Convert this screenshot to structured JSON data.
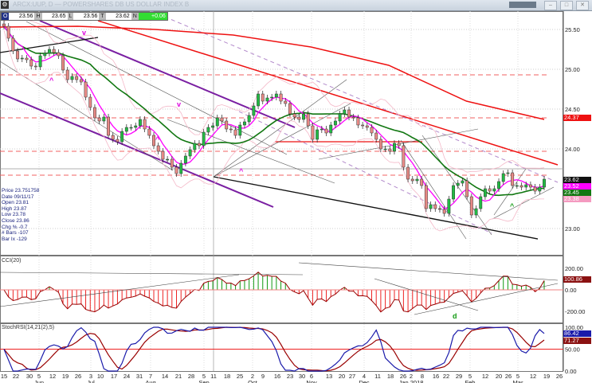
{
  "window": {
    "title": "ARCX:UUP, D — POWERSHARES DB US DOLLAR INDEX B",
    "buttons": [
      "minimize",
      "restore",
      "close"
    ]
  },
  "ohlc_bar": {
    "o_label": "O",
    "o": "23.56",
    "h_label": "H",
    "h": "23.65",
    "l_label": "L",
    "l": "23.56",
    "t_label": "T",
    "t": "23.62",
    "n_label": "N",
    "n": "+0.06"
  },
  "info_panel": {
    "price": "Price  23.751758",
    "date": "Date  09/11/17",
    "open": "Open  23.81",
    "high": "High  23.87",
    "low": "Low  23.78",
    "close": "Close  23.86",
    "chg": "Chg %  -0.7",
    "bars": "# Bars -107",
    "barix": "Bar Ix  -129"
  },
  "colors": {
    "up": "#22bb44",
    "down": "#e88a86",
    "ma_short": "#ff00ff",
    "ma_mid": "#117711",
    "ma_long": "#ee1111",
    "band": "#f4b8c8",
    "cci_pos": "#119911",
    "cci_neg": "#ee2222",
    "stoch_k": "#1a1aaa",
    "stoch_d": "#990000"
  },
  "chart_data": [
    {
      "type": "candlestick",
      "panel": "price",
      "y_ticks": [
        "25.50",
        "25.00",
        "24.50",
        "24.00",
        "23.00"
      ],
      "ylim": [
        22.67,
        25.73
      ],
      "grid": true,
      "closes": [
        25.54,
        25.39,
        25.23,
        25.13,
        25.14,
        25.12,
        25.04,
        25.03,
        25.17,
        25.2,
        25.25,
        25.21,
        25.17,
        24.99,
        24.87,
        24.91,
        24.87,
        24.84,
        24.65,
        24.52,
        24.39,
        24.35,
        24.4,
        24.17,
        24.12,
        24.09,
        24.22,
        24.27,
        24.27,
        24.29,
        24.37,
        24.25,
        24.17,
        24.04,
        23.97,
        23.87,
        23.87,
        23.77,
        23.69,
        23.82,
        23.91,
        23.99,
        24.07,
        24.04,
        24.21,
        24.27,
        24.29,
        24.39,
        24.35,
        24.25,
        24.24,
        24.17,
        24.3,
        24.34,
        24.42,
        24.54,
        24.69,
        24.6,
        24.64,
        24.65,
        24.69,
        24.6,
        24.57,
        24.44,
        24.4,
        24.37,
        24.44,
        24.29,
        24.12,
        24.24,
        24.25,
        24.2,
        24.3,
        24.35,
        24.44,
        24.49,
        24.4,
        24.39,
        24.3,
        24.29,
        24.27,
        24.2,
        24.12,
        24.0,
        24.0,
        23.97,
        24.07,
        24.04,
        23.77,
        23.62,
        23.6,
        23.62,
        23.54,
        23.25,
        23.3,
        23.25,
        23.24,
        23.19,
        23.37,
        23.54,
        23.57,
        23.6,
        23.4,
        23.17,
        23.25,
        23.4,
        23.5,
        23.47,
        23.5,
        23.59,
        23.69,
        23.7,
        23.54,
        23.54,
        23.52,
        23.55,
        23.52,
        23.47,
        23.52,
        23.62
      ],
      "ma_long_values": [
        25.53,
        25.54,
        25.5,
        25.43,
        25.28,
        25.05,
        24.6,
        24.37
      ],
      "horizontal_levels": [
        24.93,
        24.39,
        23.97,
        23.67
      ],
      "support_resistance_solid": 24.09,
      "crosshair_price": 23.75,
      "last_value_tags": [
        {
          "value": "24.37",
          "color": "#ee1111"
        },
        {
          "value": "23.62",
          "color": "#111111"
        },
        {
          "value": "23.52",
          "color": "#ff00ff"
        },
        {
          "value": "23.45",
          "color": "#117711"
        },
        {
          "value": "23.38",
          "color": "#f49ac0"
        }
      ],
      "annotations": [
        {
          "text": "v",
          "color": "#dd00dd"
        },
        {
          "text": "^",
          "color": "#dd00dd"
        },
        {
          "text": "v",
          "color": "#dd00dd"
        },
        {
          "text": "^",
          "color": "#dd00dd"
        },
        {
          "text": "^",
          "color": "#dd00dd"
        },
        {
          "text": "^",
          "color": "#119911"
        }
      ]
    },
    {
      "type": "bar",
      "panel": "cci",
      "title": "CCI(20)",
      "y_ticks": [
        "200.00",
        "0.00",
        "-200.00"
      ],
      "ylim": [
        -320,
        320
      ],
      "last_value": "100.86",
      "annotation": "d"
    },
    {
      "type": "line",
      "panel": "stochrsi",
      "title": "StochRSI(14,21(2),5)",
      "y_ticks": [
        "100.00",
        "50.00",
        "0.00"
      ],
      "ylim": [
        0,
        100
      ],
      "reference_level": 50,
      "last_values": [
        "86.42",
        "71.27"
      ]
    }
  ],
  "x_axis": {
    "day_ticks": [
      "15",
      "22",
      "30",
      "5",
      "12",
      "19",
      "26",
      "3",
      "10",
      "17",
      "24",
      "31",
      "7",
      "14",
      "21",
      "28",
      "5",
      "11",
      "18",
      "25",
      "2",
      "9",
      "16",
      "23",
      "30",
      "6",
      "13",
      "20",
      "27",
      "4",
      "11",
      "18",
      "26",
      "2",
      "8",
      "16",
      "22",
      "29",
      "5",
      "12",
      "20",
      "26",
      "5",
      "12",
      "19",
      "26"
    ],
    "months": [
      "Jun",
      "Jul",
      "Aug",
      "Sep",
      "Oct",
      "Nov",
      "Dec",
      "Jan 2018",
      "Feb",
      "Mar"
    ]
  }
}
